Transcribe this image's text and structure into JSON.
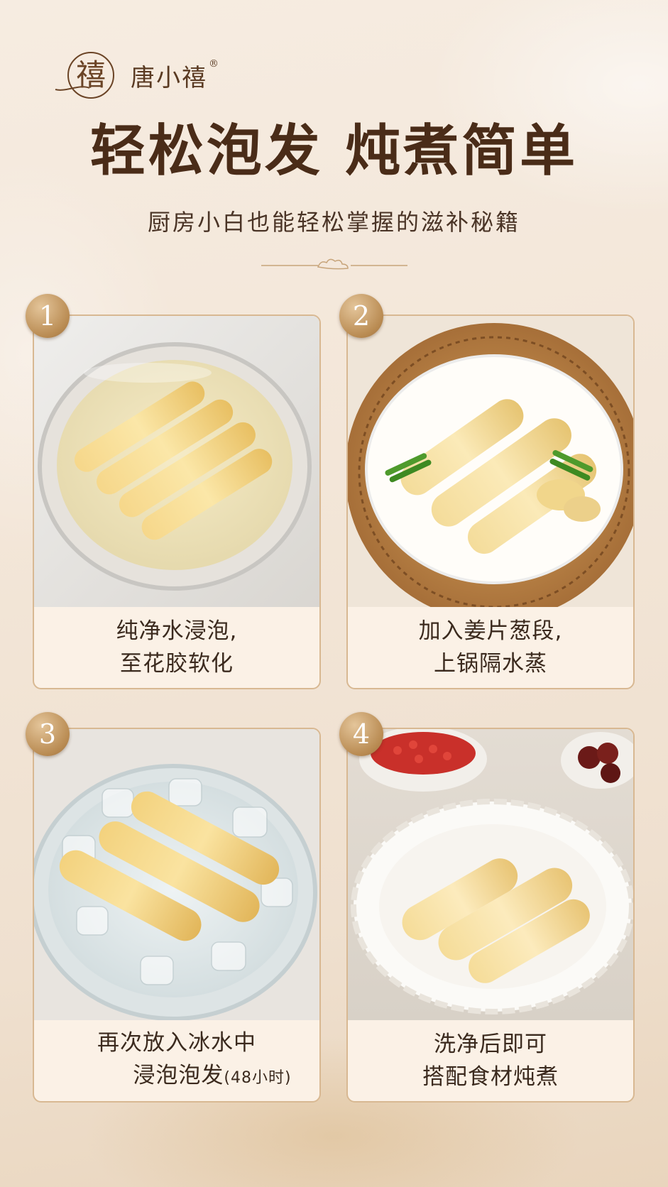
{
  "brand": {
    "name": "唐小禧",
    "registered": "®",
    "logo_glyph": "禧",
    "accent_color": "#b98b52",
    "title_color": "#4a2c18"
  },
  "header": {
    "title": "轻松泡发 炖煮简单",
    "subtitle": "厨房小白也能轻松掌握的滋补秘籍"
  },
  "steps": [
    {
      "number": "1",
      "line1": "纯净水浸泡,",
      "line2": "至花胶软化",
      "image": "bowl-of-water-soaking-fish-maw"
    },
    {
      "number": "2",
      "line1": "加入姜片葱段,",
      "line2": "上锅隔水蒸",
      "image": "steamer-plate-fish-maw-ginger-scallion"
    },
    {
      "number": "3",
      "line1": "再次放入冰水中",
      "line2": "浸泡泡发",
      "line2_note": "(48小时)",
      "image": "glass-bowl-ice-water-fish-maw"
    },
    {
      "number": "4",
      "line1": "洗净后即可",
      "line2": "搭配食材炖煮",
      "image": "white-plate-fish-maw-goji-dates"
    }
  ]
}
